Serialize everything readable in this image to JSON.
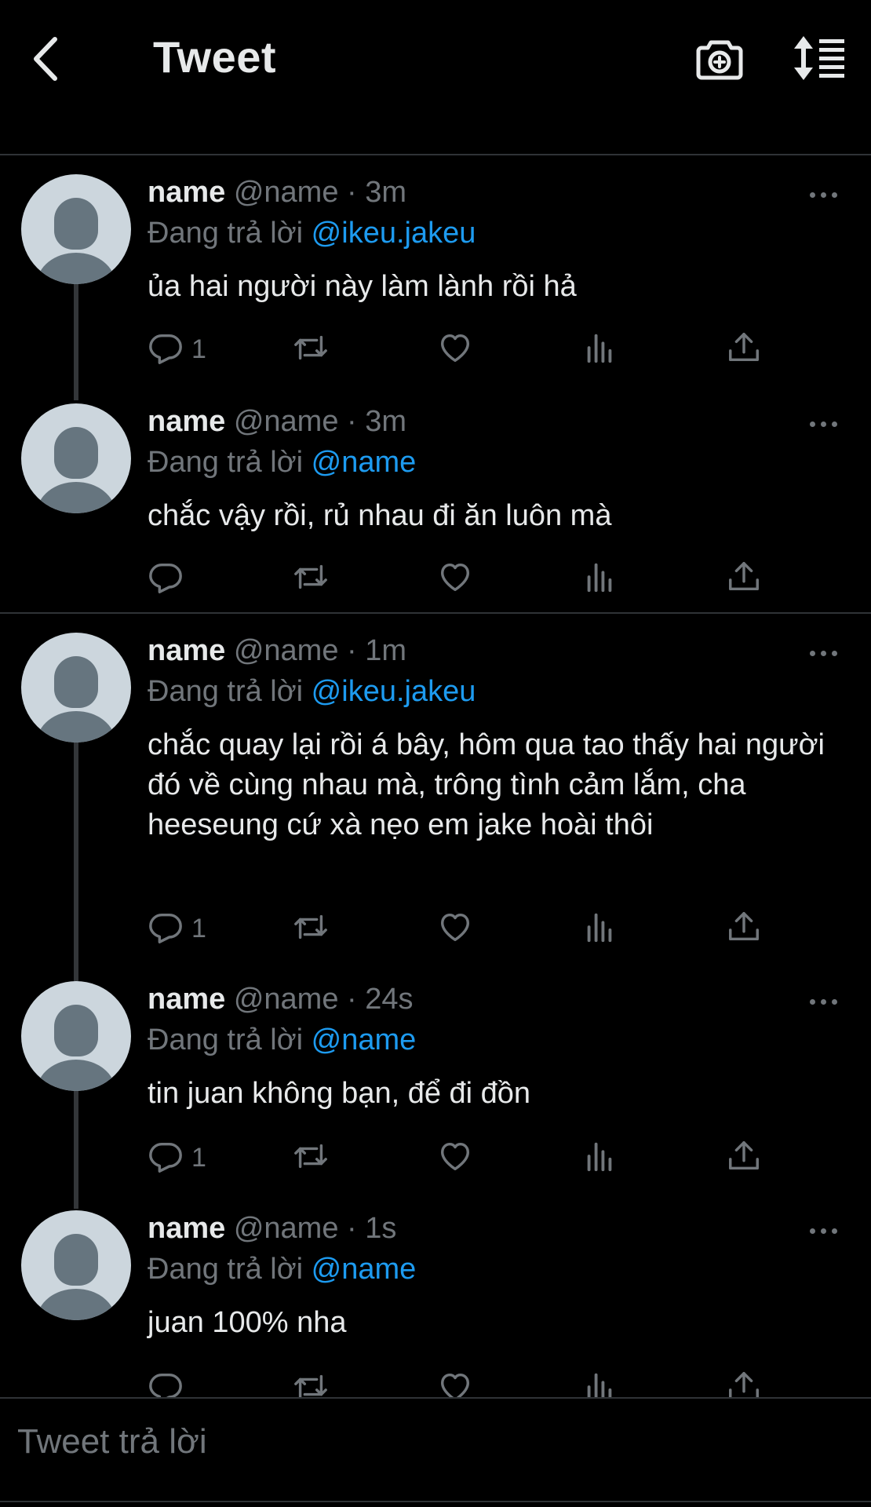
{
  "header": {
    "title": "Tweet"
  },
  "tweets": [
    {
      "name": "name",
      "handle": "@name",
      "time": "· 3m",
      "reply_label": "Đang trả lời",
      "reply_to": "@ikeu.jakeu",
      "text": "ủa hai người này làm lành rồi hả",
      "reply_count": "1"
    },
    {
      "name": "name",
      "handle": "@name",
      "time": "· 3m",
      "reply_label": "Đang trả lời",
      "reply_to": "@name",
      "text": "chắc vậy rồi, rủ nhau đi ăn luôn mà",
      "reply_count": ""
    },
    {
      "name": "name",
      "handle": "@name",
      "time": "· 1m",
      "reply_label": "Đang trả lời",
      "reply_to": "@ikeu.jakeu",
      "text": "chắc quay lại rồi á bây, hôm qua tao thấy hai người đó về cùng nhau mà, trông tình cảm lắm, cha heeseung cứ xà nẹo em jake hoài thôi",
      "reply_count": "1"
    },
    {
      "name": "name",
      "handle": "@name",
      "time": "· 24s",
      "reply_label": "Đang trả lời",
      "reply_to": "@name",
      "text": "tin juan không bạn, để đi đồn",
      "reply_count": "1"
    },
    {
      "name": "name",
      "handle": "@name",
      "time": "· 1s",
      "reply_label": "Đang trả lời",
      "reply_to": "@name",
      "text": "juan 100% nha",
      "reply_count": ""
    }
  ],
  "composer": {
    "placeholder": "Tweet trả lời"
  },
  "colors": {
    "background": "#000000",
    "text": "#e7e9ea",
    "secondary": "#71767b",
    "accent": "#1d9bf0",
    "avatar_bg": "#ccd6dd",
    "avatar_fg": "#66757f"
  },
  "icons": [
    "back-arrow-icon",
    "camera-plus-icon",
    "sort-icon",
    "reply-icon",
    "retweet-icon",
    "like-icon",
    "views-icon",
    "share-icon",
    "more-icon"
  ]
}
